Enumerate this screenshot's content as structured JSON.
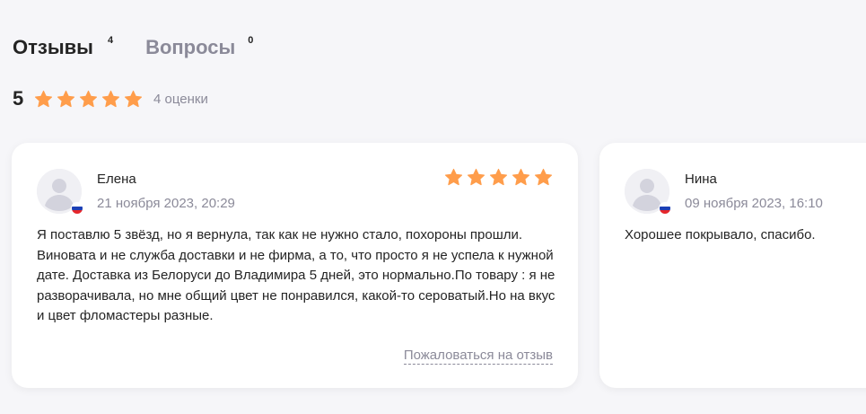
{
  "tabs": [
    {
      "label": "Отзывы",
      "count": "4"
    },
    {
      "label": "Вопросы",
      "count": "0"
    }
  ],
  "rating": {
    "value": "5",
    "stars": 5,
    "count_label": "4 оценки",
    "star_color": "#ff9d4b"
  },
  "reviews": [
    {
      "author": "Елена",
      "date": "21 ноября 2023, 20:29",
      "stars": 5,
      "text": "Я поставлю 5 звёзд, но я вернула, так как не нужно стало, похороны прошли. Виновата и не служба доставки и не фирма, а то, что просто я не успела к нужной дате. Доставка из Белоруси до Владимира 5 дней, это нормально.По товару : я не разворачивала, но мне общий цвет не понравился, какой-то сероватый.Но на вкус и цвет фломастеры разные.",
      "report_label": "Пожаловаться на отзыв",
      "avatar_icon": "user-avatar-icon",
      "flag_icon": "russia-flag-icon"
    },
    {
      "author": "Нина",
      "date": "09 ноября 2023, 16:10",
      "text": "Хорошее покрывало, спасибо.",
      "avatar_icon": "user-avatar-icon",
      "flag_icon": "russia-flag-icon"
    }
  ]
}
